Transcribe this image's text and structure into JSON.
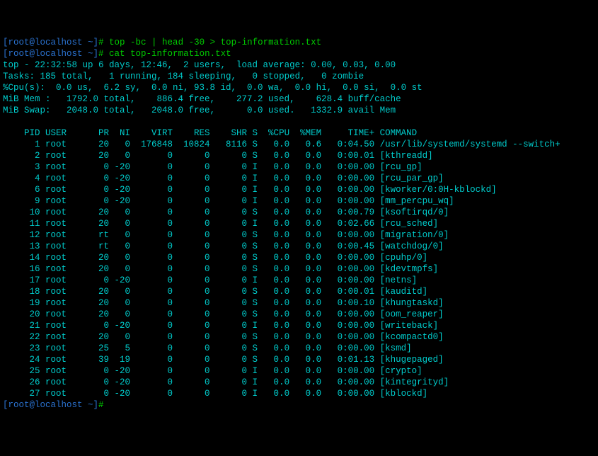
{
  "prompt1": {
    "user_host": "[root@localhost ~]",
    "delim": "# ",
    "command": "top -bc | head -30 > top-information.txt"
  },
  "prompt2": {
    "user_host": "[root@localhost ~]",
    "delim": "# ",
    "command": "cat top-information.txt"
  },
  "top_header": {
    "line1": "top - 22:32:58 up 6 days, 12:46,  2 users,  load average: 0.00, 0.03, 0.00",
    "line2": "Tasks: 185 total,   1 running, 184 sleeping,   0 stopped,   0 zombie",
    "line3": "%Cpu(s):  0.0 us,  6.2 sy,  0.0 ni, 93.8 id,  0.0 wa,  0.0 hi,  0.0 si,  0.0 st",
    "line4": "MiB Mem :   1792.0 total,    886.4 free,    277.2 used,    628.4 buff/cache",
    "line5": "MiB Swap:   2048.0 total,   2048.0 free,      0.0 used.   1332.9 avail Mem"
  },
  "columns": "    PID USER      PR  NI    VIRT    RES    SHR S  %CPU  %MEM     TIME+ COMMAND",
  "processes": [
    {
      "pid": "1",
      "user": "root",
      "pr": "20",
      "ni": "0",
      "virt": "176848",
      "res": "10824",
      "shr": "8116",
      "s": "S",
      "cpu": "0.0",
      "mem": "0.6",
      "time": "0:04.50",
      "cmd": "/usr/lib/systemd/systemd --switch+"
    },
    {
      "pid": "2",
      "user": "root",
      "pr": "20",
      "ni": "0",
      "virt": "0",
      "res": "0",
      "shr": "0",
      "s": "S",
      "cpu": "0.0",
      "mem": "0.0",
      "time": "0:00.01",
      "cmd": "[kthreadd]"
    },
    {
      "pid": "3",
      "user": "root",
      "pr": "0",
      "ni": "-20",
      "virt": "0",
      "res": "0",
      "shr": "0",
      "s": "I",
      "cpu": "0.0",
      "mem": "0.0",
      "time": "0:00.00",
      "cmd": "[rcu_gp]"
    },
    {
      "pid": "4",
      "user": "root",
      "pr": "0",
      "ni": "-20",
      "virt": "0",
      "res": "0",
      "shr": "0",
      "s": "I",
      "cpu": "0.0",
      "mem": "0.0",
      "time": "0:00.00",
      "cmd": "[rcu_par_gp]"
    },
    {
      "pid": "6",
      "user": "root",
      "pr": "0",
      "ni": "-20",
      "virt": "0",
      "res": "0",
      "shr": "0",
      "s": "I",
      "cpu": "0.0",
      "mem": "0.0",
      "time": "0:00.00",
      "cmd": "[kworker/0:0H-kblockd]"
    },
    {
      "pid": "9",
      "user": "root",
      "pr": "0",
      "ni": "-20",
      "virt": "0",
      "res": "0",
      "shr": "0",
      "s": "I",
      "cpu": "0.0",
      "mem": "0.0",
      "time": "0:00.00",
      "cmd": "[mm_percpu_wq]"
    },
    {
      "pid": "10",
      "user": "root",
      "pr": "20",
      "ni": "0",
      "virt": "0",
      "res": "0",
      "shr": "0",
      "s": "S",
      "cpu": "0.0",
      "mem": "0.0",
      "time": "0:00.79",
      "cmd": "[ksoftirqd/0]"
    },
    {
      "pid": "11",
      "user": "root",
      "pr": "20",
      "ni": "0",
      "virt": "0",
      "res": "0",
      "shr": "0",
      "s": "I",
      "cpu": "0.0",
      "mem": "0.0",
      "time": "0:02.66",
      "cmd": "[rcu_sched]"
    },
    {
      "pid": "12",
      "user": "root",
      "pr": "rt",
      "ni": "0",
      "virt": "0",
      "res": "0",
      "shr": "0",
      "s": "S",
      "cpu": "0.0",
      "mem": "0.0",
      "time": "0:00.00",
      "cmd": "[migration/0]"
    },
    {
      "pid": "13",
      "user": "root",
      "pr": "rt",
      "ni": "0",
      "virt": "0",
      "res": "0",
      "shr": "0",
      "s": "S",
      "cpu": "0.0",
      "mem": "0.0",
      "time": "0:00.45",
      "cmd": "[watchdog/0]"
    },
    {
      "pid": "14",
      "user": "root",
      "pr": "20",
      "ni": "0",
      "virt": "0",
      "res": "0",
      "shr": "0",
      "s": "S",
      "cpu": "0.0",
      "mem": "0.0",
      "time": "0:00.00",
      "cmd": "[cpuhp/0]"
    },
    {
      "pid": "16",
      "user": "root",
      "pr": "20",
      "ni": "0",
      "virt": "0",
      "res": "0",
      "shr": "0",
      "s": "S",
      "cpu": "0.0",
      "mem": "0.0",
      "time": "0:00.00",
      "cmd": "[kdevtmpfs]"
    },
    {
      "pid": "17",
      "user": "root",
      "pr": "0",
      "ni": "-20",
      "virt": "0",
      "res": "0",
      "shr": "0",
      "s": "I",
      "cpu": "0.0",
      "mem": "0.0",
      "time": "0:00.00",
      "cmd": "[netns]"
    },
    {
      "pid": "18",
      "user": "root",
      "pr": "20",
      "ni": "0",
      "virt": "0",
      "res": "0",
      "shr": "0",
      "s": "S",
      "cpu": "0.0",
      "mem": "0.0",
      "time": "0:00.01",
      "cmd": "[kauditd]"
    },
    {
      "pid": "19",
      "user": "root",
      "pr": "20",
      "ni": "0",
      "virt": "0",
      "res": "0",
      "shr": "0",
      "s": "S",
      "cpu": "0.0",
      "mem": "0.0",
      "time": "0:00.10",
      "cmd": "[khungtaskd]"
    },
    {
      "pid": "20",
      "user": "root",
      "pr": "20",
      "ni": "0",
      "virt": "0",
      "res": "0",
      "shr": "0",
      "s": "S",
      "cpu": "0.0",
      "mem": "0.0",
      "time": "0:00.00",
      "cmd": "[oom_reaper]"
    },
    {
      "pid": "21",
      "user": "root",
      "pr": "0",
      "ni": "-20",
      "virt": "0",
      "res": "0",
      "shr": "0",
      "s": "I",
      "cpu": "0.0",
      "mem": "0.0",
      "time": "0:00.00",
      "cmd": "[writeback]"
    },
    {
      "pid": "22",
      "user": "root",
      "pr": "20",
      "ni": "0",
      "virt": "0",
      "res": "0",
      "shr": "0",
      "s": "S",
      "cpu": "0.0",
      "mem": "0.0",
      "time": "0:00.00",
      "cmd": "[kcompactd0]"
    },
    {
      "pid": "23",
      "user": "root",
      "pr": "25",
      "ni": "5",
      "virt": "0",
      "res": "0",
      "shr": "0",
      "s": "S",
      "cpu": "0.0",
      "mem": "0.0",
      "time": "0:00.00",
      "cmd": "[ksmd]"
    },
    {
      "pid": "24",
      "user": "root",
      "pr": "39",
      "ni": "19",
      "virt": "0",
      "res": "0",
      "shr": "0",
      "s": "S",
      "cpu": "0.0",
      "mem": "0.0",
      "time": "0:01.13",
      "cmd": "[khugepaged]"
    },
    {
      "pid": "25",
      "user": "root",
      "pr": "0",
      "ni": "-20",
      "virt": "0",
      "res": "0",
      "shr": "0",
      "s": "I",
      "cpu": "0.0",
      "mem": "0.0",
      "time": "0:00.00",
      "cmd": "[crypto]"
    },
    {
      "pid": "26",
      "user": "root",
      "pr": "0",
      "ni": "-20",
      "virt": "0",
      "res": "0",
      "shr": "0",
      "s": "I",
      "cpu": "0.0",
      "mem": "0.0",
      "time": "0:00.00",
      "cmd": "[kintegrityd]"
    },
    {
      "pid": "27",
      "user": "root",
      "pr": "0",
      "ni": "-20",
      "virt": "0",
      "res": "0",
      "shr": "0",
      "s": "I",
      "cpu": "0.0",
      "mem": "0.0",
      "time": "0:00.00",
      "cmd": "[kblockd]"
    }
  ],
  "prompt3": {
    "user_host": "[root@localhost ~]",
    "delim": "# "
  }
}
